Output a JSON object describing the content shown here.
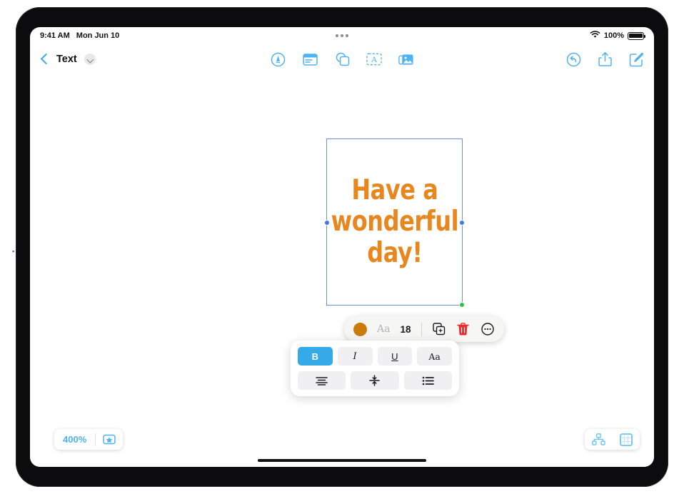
{
  "status_bar": {
    "time": "9:41 AM",
    "date": "Mon Jun 10",
    "battery_percent": "100%",
    "wifi_icon": "wifi-icon",
    "battery_icon": "battery-full-icon",
    "multitask_handle": "multitasking-dots-handle"
  },
  "navbar": {
    "back_icon": "chevron-left-icon",
    "document_title": "Text",
    "title_menu_icon": "chevron-down-icon",
    "tools": [
      {
        "name": "draw-tool",
        "icon": "pen-circle-icon"
      },
      {
        "name": "format-tool",
        "icon": "format-panel-icon"
      },
      {
        "name": "shapes-tool",
        "icon": "shapes-icon"
      },
      {
        "name": "text-box-tool",
        "icon": "text-box-icon"
      },
      {
        "name": "media-tool",
        "icon": "photos-icon"
      }
    ],
    "actions": [
      {
        "name": "undo-button",
        "icon": "undo-circle-icon"
      },
      {
        "name": "share-button",
        "icon": "share-icon"
      },
      {
        "name": "compose-button",
        "icon": "compose-pencil-icon"
      }
    ]
  },
  "canvas": {
    "text_object": {
      "content": "Have a\nwonderful\nday!",
      "color": "#e8871e",
      "selection_border_color": "#6b8fe8",
      "handles": [
        {
          "name": "resize-handle-left",
          "color": "#3f7be8"
        },
        {
          "name": "resize-handle-right",
          "color": "#3f7be8"
        },
        {
          "name": "resize-handle-corner",
          "color": "#2fc04a"
        }
      ]
    }
  },
  "context_toolbar": {
    "color_swatch": {
      "name": "text-color-swatch",
      "color": "#cc7a0a"
    },
    "font_label": "Aa",
    "font_size": "18",
    "items": [
      {
        "name": "duplicate-button",
        "icon": "duplicate-icon"
      },
      {
        "name": "delete-button",
        "icon": "trash-icon",
        "color": "#ef2c2c"
      },
      {
        "name": "more-options-button",
        "icon": "more-circle-icon"
      }
    ]
  },
  "format_panel": {
    "row1": [
      {
        "name": "bold-button",
        "label": "B",
        "active": true
      },
      {
        "name": "italic-button",
        "label": "I",
        "active": false
      },
      {
        "name": "underline-button",
        "label": "U",
        "active": false
      },
      {
        "name": "font-style-button",
        "label": "Aa",
        "active": false
      }
    ],
    "row2": [
      {
        "name": "align-center-button",
        "icon": "align-center-icon"
      },
      {
        "name": "vertical-align-button",
        "icon": "vertical-align-middle-icon"
      },
      {
        "name": "bulleted-list-button",
        "icon": "bulleted-list-icon"
      }
    ],
    "active_color": "#35aae8"
  },
  "bottom_bar": {
    "zoom_level": "400%",
    "favorites_icon": "star-rect-icon",
    "organize_icon": "hierarchy-icon",
    "canvas_icon": "grid-canvas-icon"
  }
}
